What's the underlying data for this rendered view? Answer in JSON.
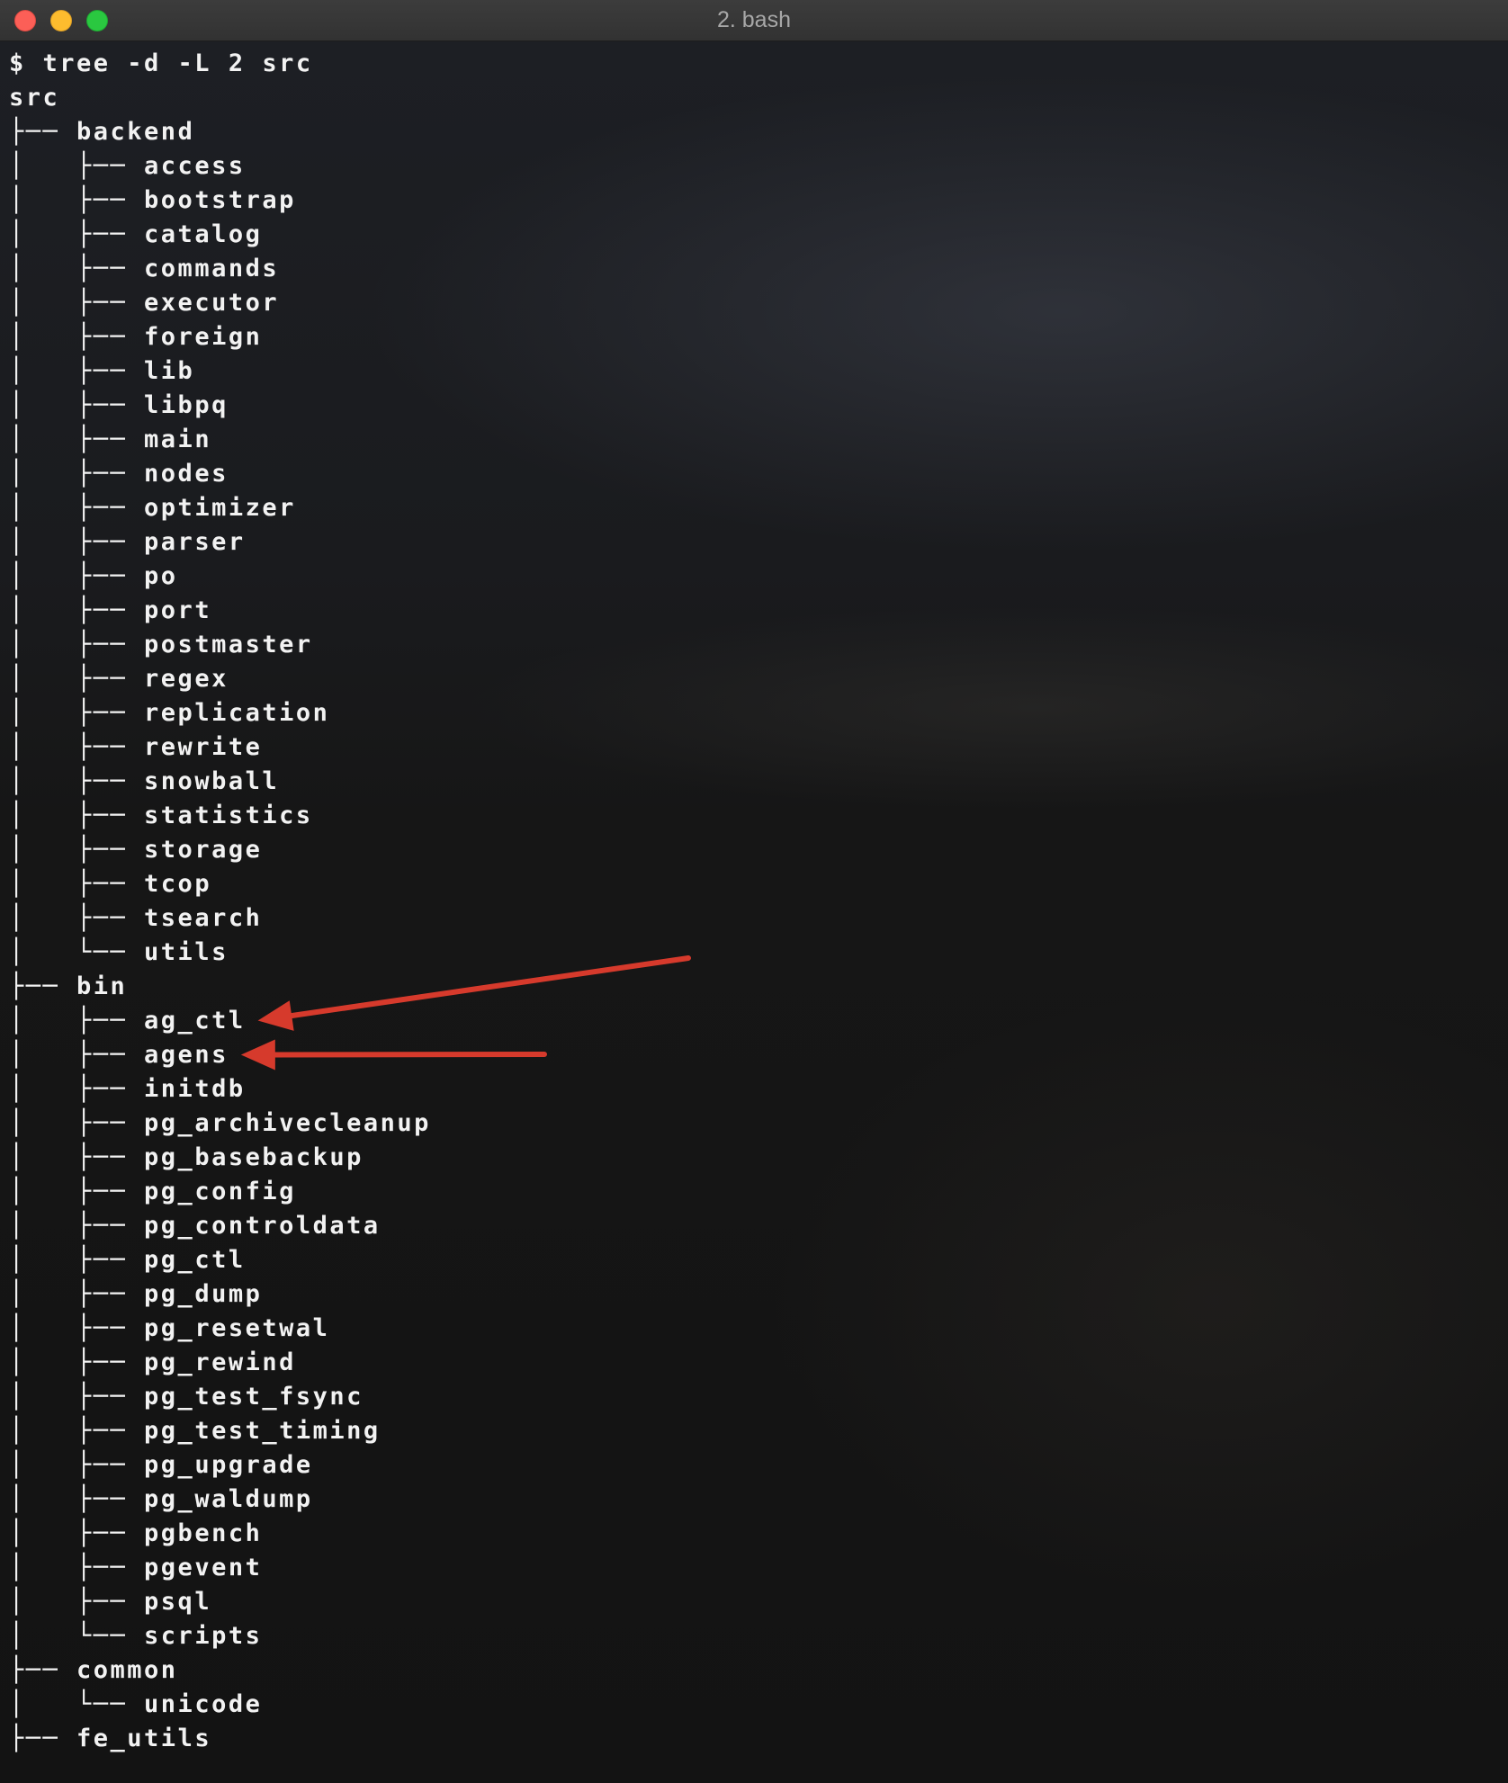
{
  "window": {
    "title": "2. bash",
    "controls": {
      "close_color": "#fc5f57",
      "minimize_color": "#fdbc2e",
      "maximize_color": "#2ac840"
    }
  },
  "terminal": {
    "command_line": "$ tree -d -L 2 src",
    "root": "src",
    "tree": [
      {
        "prefix": "├── ",
        "name": "backend",
        "level": 1
      },
      {
        "prefix": "│   ├── ",
        "name": "access",
        "level": 2
      },
      {
        "prefix": "│   ├── ",
        "name": "bootstrap",
        "level": 2
      },
      {
        "prefix": "│   ├── ",
        "name": "catalog",
        "level": 2
      },
      {
        "prefix": "│   ├── ",
        "name": "commands",
        "level": 2
      },
      {
        "prefix": "│   ├── ",
        "name": "executor",
        "level": 2
      },
      {
        "prefix": "│   ├── ",
        "name": "foreign",
        "level": 2
      },
      {
        "prefix": "│   ├── ",
        "name": "lib",
        "level": 2
      },
      {
        "prefix": "│   ├── ",
        "name": "libpq",
        "level": 2
      },
      {
        "prefix": "│   ├── ",
        "name": "main",
        "level": 2
      },
      {
        "prefix": "│   ├── ",
        "name": "nodes",
        "level": 2
      },
      {
        "prefix": "│   ├── ",
        "name": "optimizer",
        "level": 2
      },
      {
        "prefix": "│   ├── ",
        "name": "parser",
        "level": 2
      },
      {
        "prefix": "│   ├── ",
        "name": "po",
        "level": 2
      },
      {
        "prefix": "│   ├── ",
        "name": "port",
        "level": 2
      },
      {
        "prefix": "│   ├── ",
        "name": "postmaster",
        "level": 2
      },
      {
        "prefix": "│   ├── ",
        "name": "regex",
        "level": 2
      },
      {
        "prefix": "│   ├── ",
        "name": "replication",
        "level": 2
      },
      {
        "prefix": "│   ├── ",
        "name": "rewrite",
        "level": 2
      },
      {
        "prefix": "│   ├── ",
        "name": "snowball",
        "level": 2
      },
      {
        "prefix": "│   ├── ",
        "name": "statistics",
        "level": 2
      },
      {
        "prefix": "│   ├── ",
        "name": "storage",
        "level": 2
      },
      {
        "prefix": "│   ├── ",
        "name": "tcop",
        "level": 2
      },
      {
        "prefix": "│   ├── ",
        "name": "tsearch",
        "level": 2
      },
      {
        "prefix": "│   └── ",
        "name": "utils",
        "level": 2
      },
      {
        "prefix": "├── ",
        "name": "bin",
        "level": 1
      },
      {
        "prefix": "│   ├── ",
        "name": "ag_ctl",
        "level": 2
      },
      {
        "prefix": "│   ├── ",
        "name": "agens",
        "level": 2
      },
      {
        "prefix": "│   ├── ",
        "name": "initdb",
        "level": 2
      },
      {
        "prefix": "│   ├── ",
        "name": "pg_archivecleanup",
        "level": 2
      },
      {
        "prefix": "│   ├── ",
        "name": "pg_basebackup",
        "level": 2
      },
      {
        "prefix": "│   ├── ",
        "name": "pg_config",
        "level": 2
      },
      {
        "prefix": "│   ├── ",
        "name": "pg_controldata",
        "level": 2
      },
      {
        "prefix": "│   ├── ",
        "name": "pg_ctl",
        "level": 2
      },
      {
        "prefix": "│   ├── ",
        "name": "pg_dump",
        "level": 2
      },
      {
        "prefix": "│   ├── ",
        "name": "pg_resetwal",
        "level": 2
      },
      {
        "prefix": "│   ├── ",
        "name": "pg_rewind",
        "level": 2
      },
      {
        "prefix": "│   ├── ",
        "name": "pg_test_fsync",
        "level": 2
      },
      {
        "prefix": "│   ├── ",
        "name": "pg_test_timing",
        "level": 2
      },
      {
        "prefix": "│   ├── ",
        "name": "pg_upgrade",
        "level": 2
      },
      {
        "prefix": "│   ├── ",
        "name": "pg_waldump",
        "level": 2
      },
      {
        "prefix": "│   ├── ",
        "name": "pgbench",
        "level": 2
      },
      {
        "prefix": "│   ├── ",
        "name": "pgevent",
        "level": 2
      },
      {
        "prefix": "│   ├── ",
        "name": "psql",
        "level": 2
      },
      {
        "prefix": "│   └── ",
        "name": "scripts",
        "level": 2
      },
      {
        "prefix": "├── ",
        "name": "common",
        "level": 1
      },
      {
        "prefix": "│   └── ",
        "name": "unicode",
        "level": 2
      },
      {
        "prefix": "├── ",
        "name": "fe_utils",
        "level": 1
      }
    ]
  },
  "annotations": {
    "arrow_color": "#d63a2c",
    "arrow_targets": [
      "ag_ctl",
      "agens"
    ]
  }
}
